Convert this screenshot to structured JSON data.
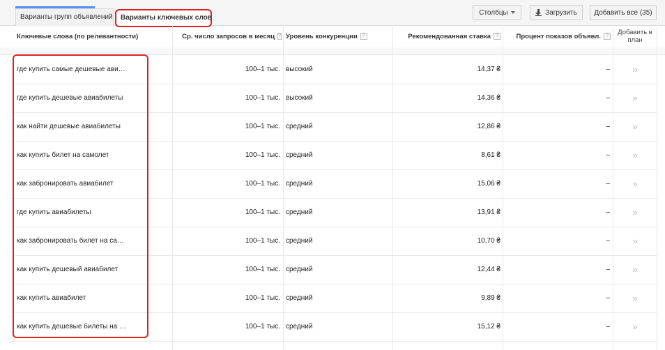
{
  "tabs": [
    {
      "label": "Варианты групп объявлений"
    },
    {
      "label": "Варианты ключевых слов"
    }
  ],
  "toolbar": {
    "columns_label": "Столбцы",
    "download_label": "Загрузить",
    "add_all_label": "Добавить все (35)"
  },
  "table": {
    "headers": {
      "keyword": "Ключевые слова (по релевантности)",
      "volume": "Ср. число запросов в месяц",
      "competition": "Уровень конкуренции",
      "bid": "Рекомендованная ставка",
      "impression_share": "Процент показов объявл.",
      "add_to_plan_1": "Добавить в",
      "add_to_plan_2": "план",
      "help_mark": "?"
    },
    "rows": [
      {
        "keyword": "где купить самые дешевые ави…",
        "volume": "100–1 тыс.",
        "competition": "высокий",
        "bid": "14,37 ₴",
        "share": "–",
        "add": "»"
      },
      {
        "keyword": "где купить дешевые авиабилеты",
        "volume": "100–1 тыс.",
        "competition": "высокий",
        "bid": "14,36 ₴",
        "share": "–",
        "add": "»"
      },
      {
        "keyword": "как найти дешевые авиабилеты",
        "volume": "100–1 тыс.",
        "competition": "средний",
        "bid": "12,86 ₴",
        "share": "–",
        "add": "»"
      },
      {
        "keyword": "как купить билет на самолет",
        "volume": "100–1 тыс.",
        "competition": "средний",
        "bid": "8,61 ₴",
        "share": "–",
        "add": "»"
      },
      {
        "keyword": "как забронировать авиабилет",
        "volume": "100–1 тыс.",
        "competition": "средний",
        "bid": "15,06 ₴",
        "share": "–",
        "add": "»"
      },
      {
        "keyword": "где купить авиабилеты",
        "volume": "100–1 тыс.",
        "competition": "средний",
        "bid": "13,91 ₴",
        "share": "–",
        "add": "»"
      },
      {
        "keyword": "как забронировать билет на са…",
        "volume": "100–1 тыс.",
        "competition": "средний",
        "bid": "10,70 ₴",
        "share": "–",
        "add": "»"
      },
      {
        "keyword": "как купить дешевый авиабилет",
        "volume": "100–1 тыс.",
        "competition": "средний",
        "bid": "12,44 ₴",
        "share": "–",
        "add": "»"
      },
      {
        "keyword": "как купить авиабилет",
        "volume": "100–1 тыс.",
        "competition": "средний",
        "bid": "9,89 ₴",
        "share": "–",
        "add": "»"
      },
      {
        "keyword": "как купить дешевые билеты на …",
        "volume": "100–1 тыс.",
        "competition": "средний",
        "bid": "15,12 ₴",
        "share": "–",
        "add": "»"
      }
    ]
  },
  "colors": {
    "tab_accent": "#4d90fe",
    "highlight": "#e02020"
  }
}
